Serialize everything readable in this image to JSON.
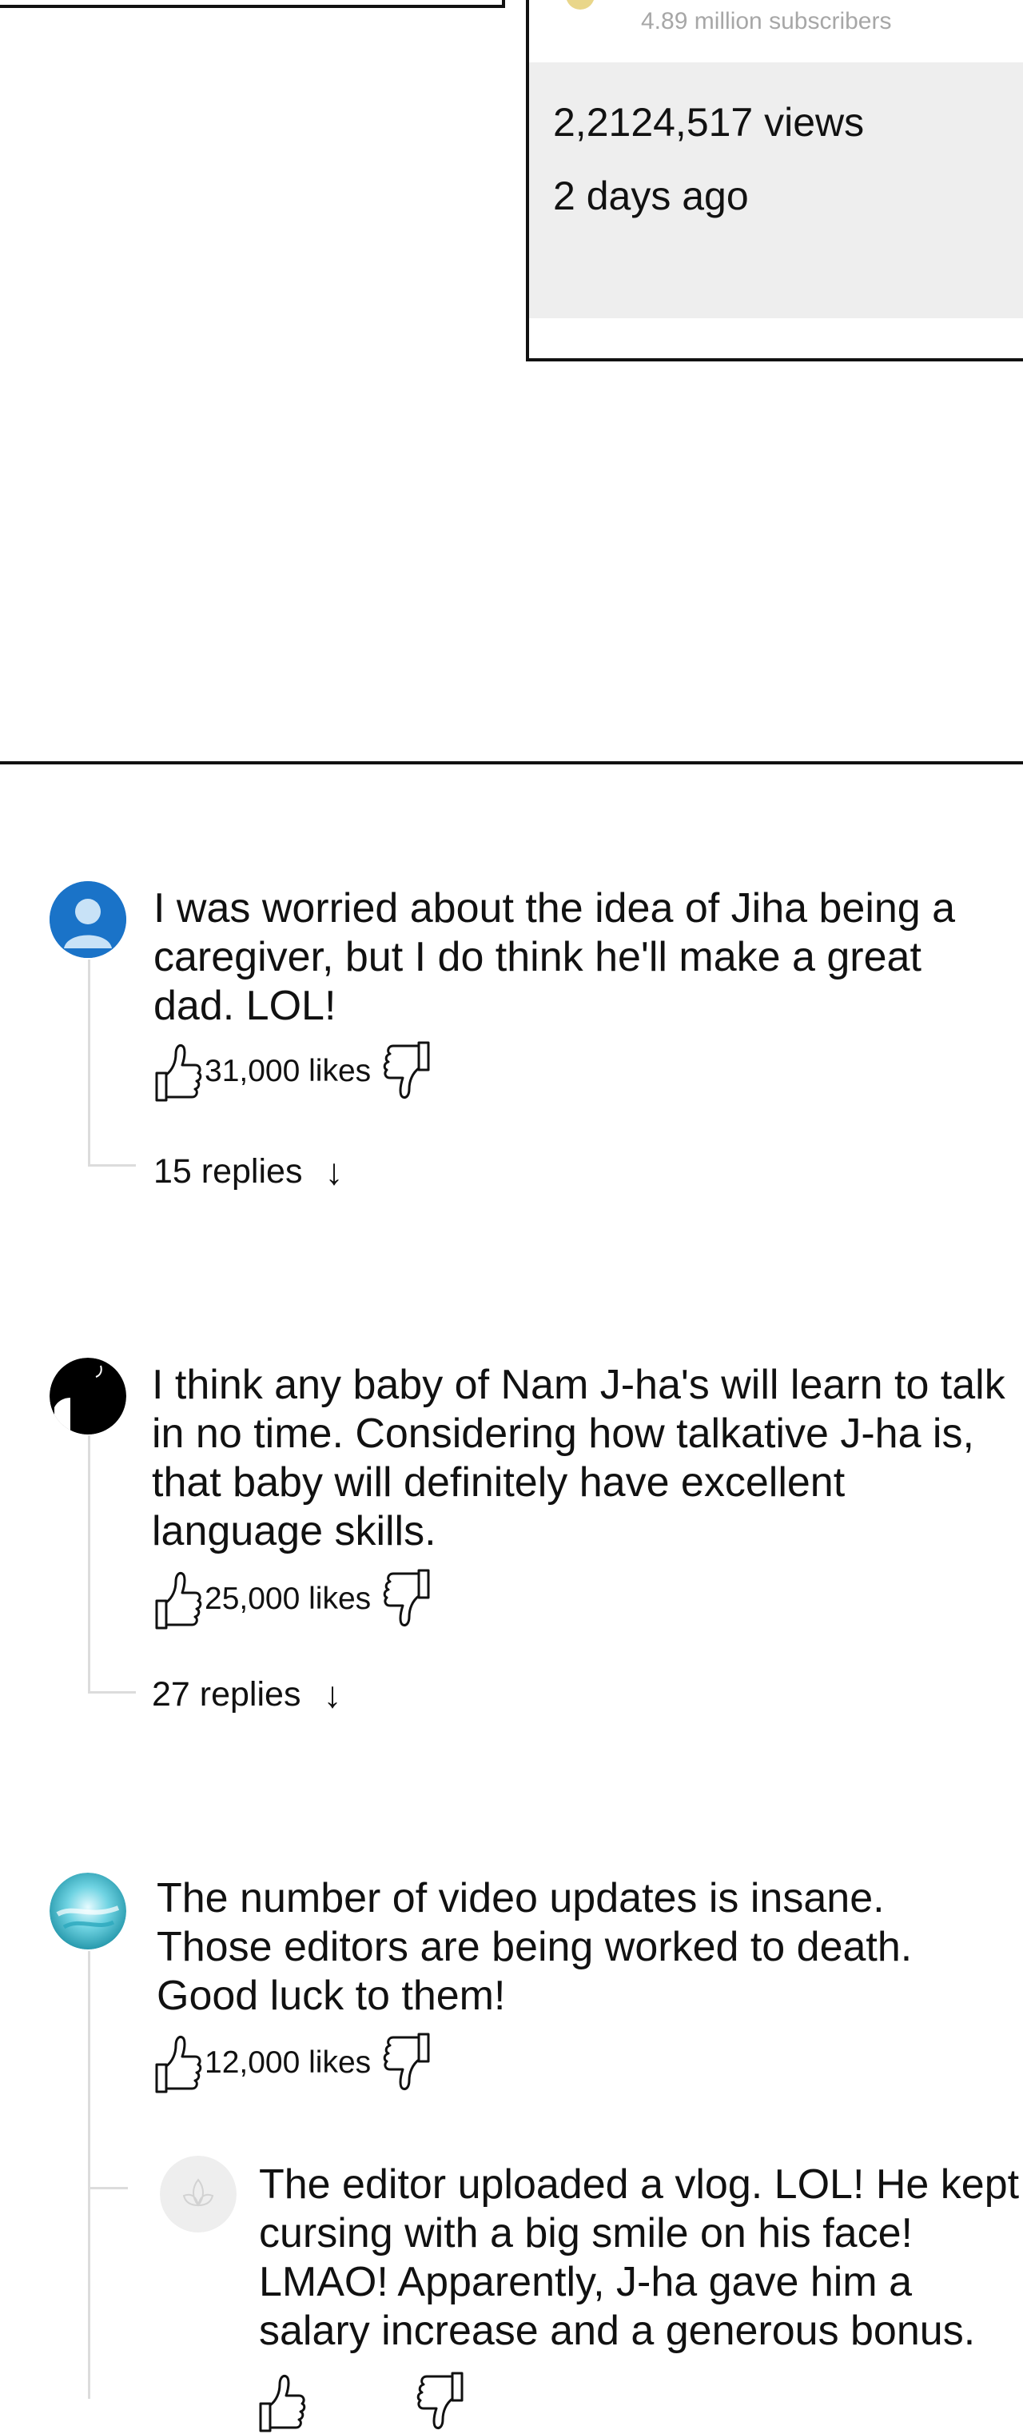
{
  "video_info": {
    "subscribers": "4.89 million subscribers",
    "views": "2,2124,517 views",
    "posted": "2 days ago"
  },
  "comments": [
    {
      "avatar_icon": "user-silhouette-icon",
      "avatar_color": "#1a73c8",
      "text": "I was worried about the idea of Jiha being a caregiver, but I do think he'll make a great dad. LOL!",
      "likes": "31,000 likes",
      "replies": "15 replies"
    },
    {
      "avatar_icon": "black-hair-avatar-icon",
      "avatar_color": "#000000",
      "text": "I think any baby of Nam J-ha's will learn to talk in no time. Considering how talkative J-ha is, that baby will definitely have excellent language skills.",
      "likes": "25,000 likes",
      "replies": "27 replies"
    },
    {
      "avatar_icon": "teal-abstract-avatar-icon",
      "avatar_color": "#41b9c9",
      "text": "The number of video updates is insane. Those editors are being worked to death. Good luck to them!",
      "likes": "12,000 likes",
      "reply": {
        "avatar_icon": "flower-avatar-icon",
        "avatar_color": "#eeeeee",
        "text": "The editor uploaded a vlog. LOL! He kept cursing with a big smile on his face! LMAO! Apparently, J-ha gave him a salary increase and a generous bonus."
      }
    }
  ]
}
